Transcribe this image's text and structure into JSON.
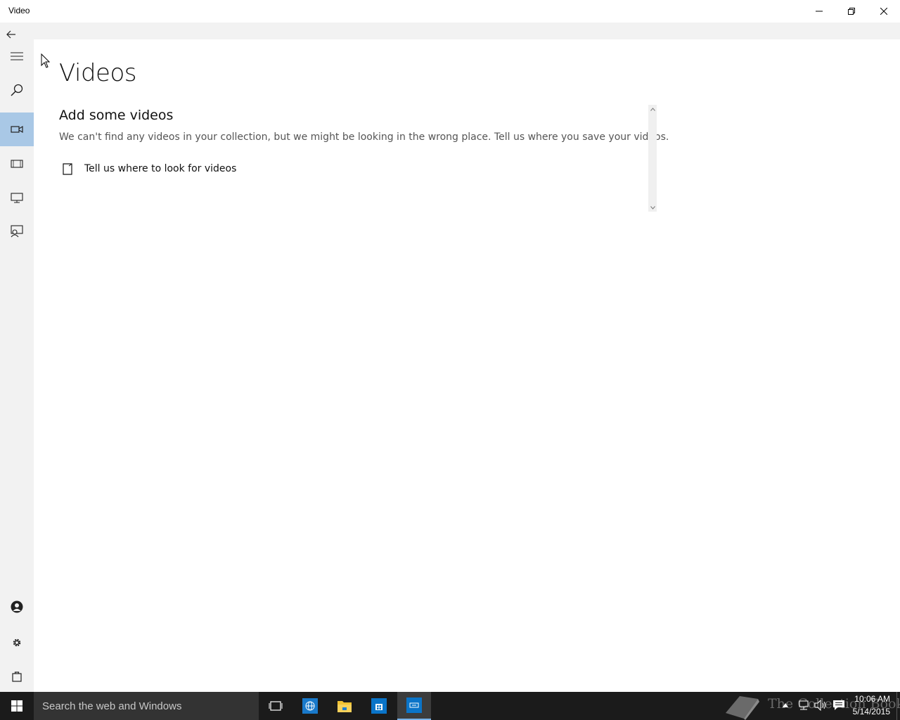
{
  "window": {
    "title": "Video"
  },
  "nav": {
    "items": [
      {
        "icon": "hamburger-icon"
      },
      {
        "icon": "search-icon"
      },
      {
        "icon": "video-camera-icon",
        "selected": true
      },
      {
        "icon": "film-icon"
      },
      {
        "icon": "tv-icon"
      },
      {
        "icon": "presenter-icon"
      }
    ],
    "bottom": [
      {
        "icon": "account-icon"
      },
      {
        "icon": "gear-icon"
      },
      {
        "icon": "store-bag-icon"
      }
    ]
  },
  "main": {
    "title": "Videos",
    "section_title": "Add some videos",
    "section_desc": "We can't find any videos in your collection, but we might be looking in the wrong place. Tell us where you save your videos.",
    "link_label": "Tell us where to look for videos"
  },
  "taskbar": {
    "search_placeholder": "Search the web and Windows",
    "watermark": "The Collection Book",
    "time": "10:06 AM",
    "date": "5/14/2015"
  },
  "colors": {
    "accent_selected": "#a9c8e6",
    "taskbar": "#1b1b1b",
    "rail": "#f2f2f2",
    "ie_blue": "#1979ca",
    "explorer_yellow": "#f0c233",
    "store_blue": "#0a74c8"
  }
}
